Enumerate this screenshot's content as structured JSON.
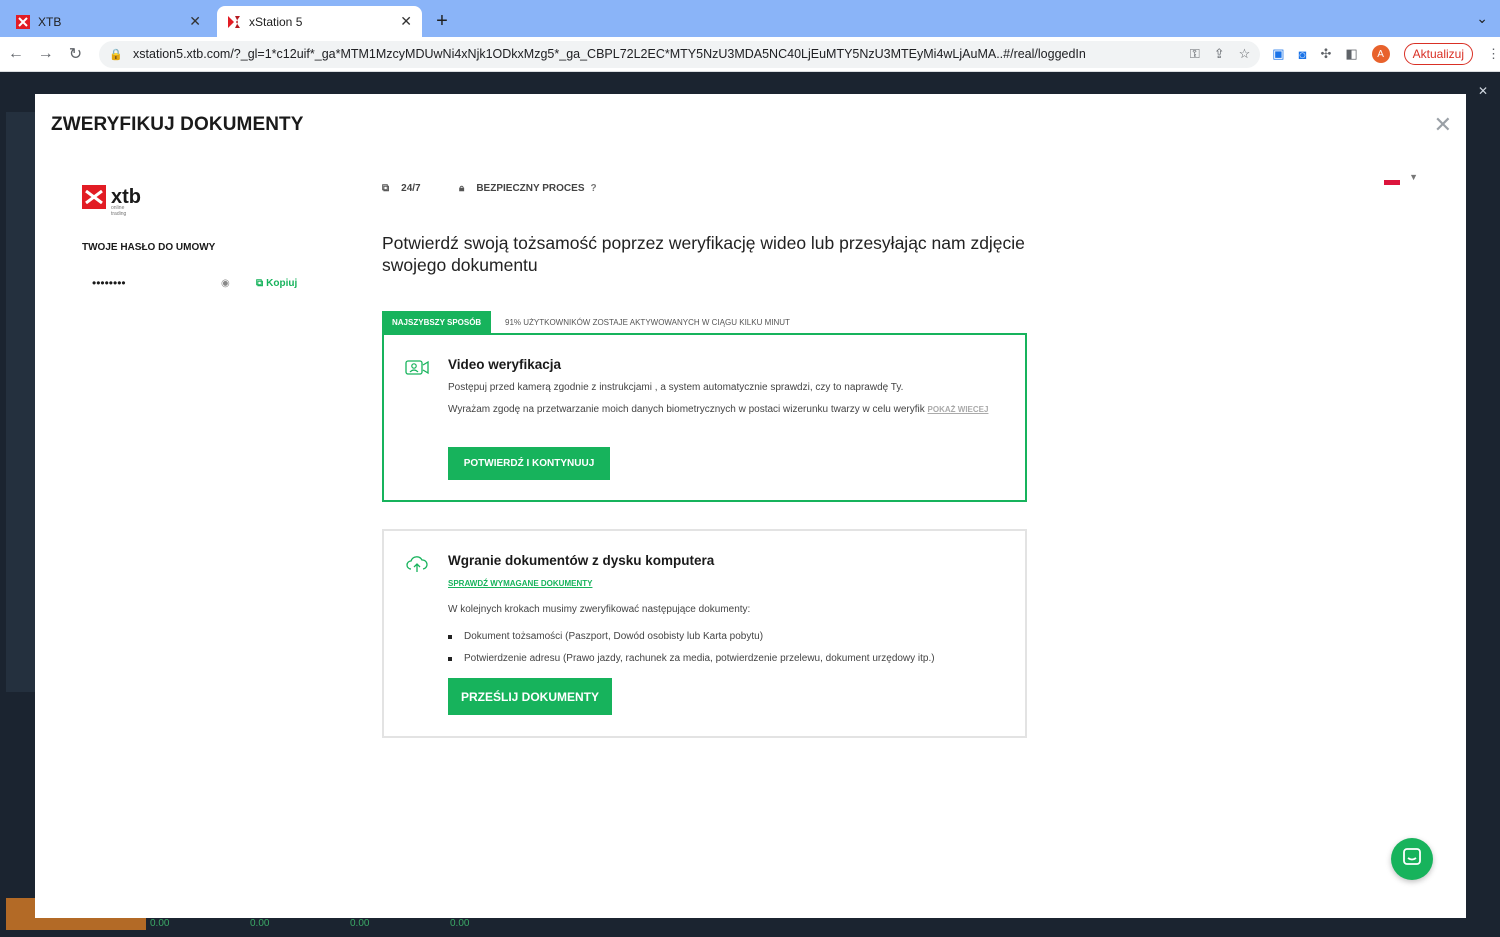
{
  "browser": {
    "tabs": [
      {
        "title": "XTB"
      },
      {
        "title": "xStation 5"
      }
    ],
    "url": "xstation5.xtb.com/?_gl=1*c12uif*_ga*MTM1MzcyMDUwNi4xNjk1ODkxMzg5*_ga_CBPL72L2EC*MTY5NzU3MDA5NC40LjEuMTY5NzU3MTEyMi4wLjAuMA..#/real/loggedIn",
    "profile_initial": "A",
    "update_label": "Aktualizuj"
  },
  "background": {
    "bottom_values": [
      "0.00",
      "0.00",
      "0.00",
      "0.00"
    ]
  },
  "modal": {
    "title": "ZWERYFIKUJ DOKUMENTY",
    "logo": {
      "name": "xtb",
      "tagline": "online trading"
    },
    "password_label": "TWOJE HASŁO DO UMOWY",
    "password_value": "••••••••",
    "copy_label": "Kopiuj",
    "features": [
      {
        "label": "24/7"
      },
      {
        "label": "BEZPIECZNY PROCES"
      }
    ],
    "headline": "Potwierdź swoją tożsamość poprzez weryfikację wideo lub przesyłając nam zdjęcie swojego dokumentu",
    "fastest_badge": "NAJSZYBSZY SPOSÓB",
    "fastest_note": "91% UŻYTKOWNIKÓW ZOSTAJE AKTYWOWANYCH W CIĄGU KILKU MINUT",
    "video": {
      "title": "Video weryfikacja",
      "text1": "Postępuj przed kamerą zgodnie z instrukcjami , a system automatycznie sprawdzi, czy to naprawdę Ty.",
      "text2": "Wyrażam zgodę na przetwarzanie moich danych biometrycznych w postaci wizerunku twarzy w celu weryfik",
      "more": "POKAŻ WIECEJ",
      "button": "POTWIERDŹ I KONTYNUUJ"
    },
    "upload": {
      "title": "Wgranie dokumentów z dysku komputera",
      "check_link": "SPRAWDŹ WYMAGANE DOKUMENTY",
      "intro": "W kolejnych krokach musimy zweryfikować następujące dokumenty:",
      "items": [
        "Dokument tożsamości (Paszport, Dowód osobisty lub Karta pobytu)",
        "Potwierdzenie adresu (Prawo jazdy, rachunek za media, potwierdzenie przelewu, dokument urzędowy itp.)"
      ],
      "button": "PRZEŚLIJ DOKUMENTY"
    }
  },
  "colors": {
    "accent": "#17b35c",
    "brand_red": "#e21c24"
  }
}
